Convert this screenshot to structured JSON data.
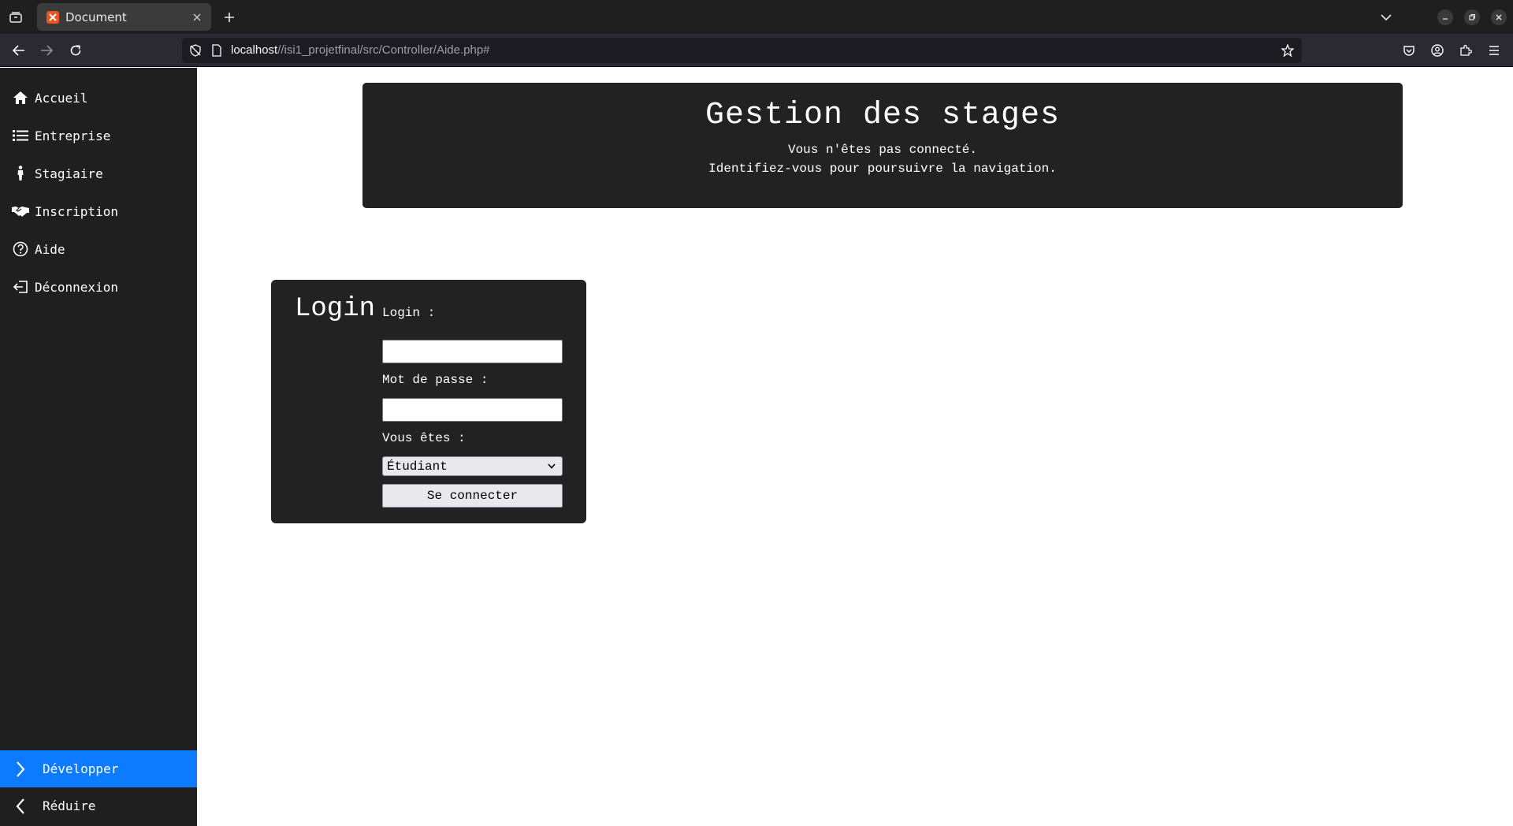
{
  "browser": {
    "tab_title": "Document",
    "url_host": "localhost",
    "url_path": "//isi1_projetfinal/src/Controller/Aide.php#"
  },
  "sidebar": {
    "items": [
      {
        "label": "Accueil",
        "icon": "home-icon"
      },
      {
        "label": "Entreprise",
        "icon": "list-icon"
      },
      {
        "label": "Stagiaire",
        "icon": "person-icon"
      },
      {
        "label": "Inscription",
        "icon": "handshake-icon"
      },
      {
        "label": "Aide",
        "icon": "help-circle-icon"
      },
      {
        "label": "Déconnexion",
        "icon": "logout-icon"
      }
    ],
    "expand_label": "Développer",
    "collapse_label": "Réduire",
    "accent_color": "#0d7bff"
  },
  "header": {
    "title": "Gestion des stages",
    "line1": "Vous n'êtes pas connecté.",
    "line2": "Identifiez-vous pour poursuivre la navigation."
  },
  "login": {
    "title": "Login",
    "login_label": "Login :",
    "login_value": "",
    "password_label": "Mot de passe :",
    "password_value": "",
    "role_label": "Vous êtes :",
    "role_selected": "Étudiant",
    "submit_label": "Se connecter"
  }
}
